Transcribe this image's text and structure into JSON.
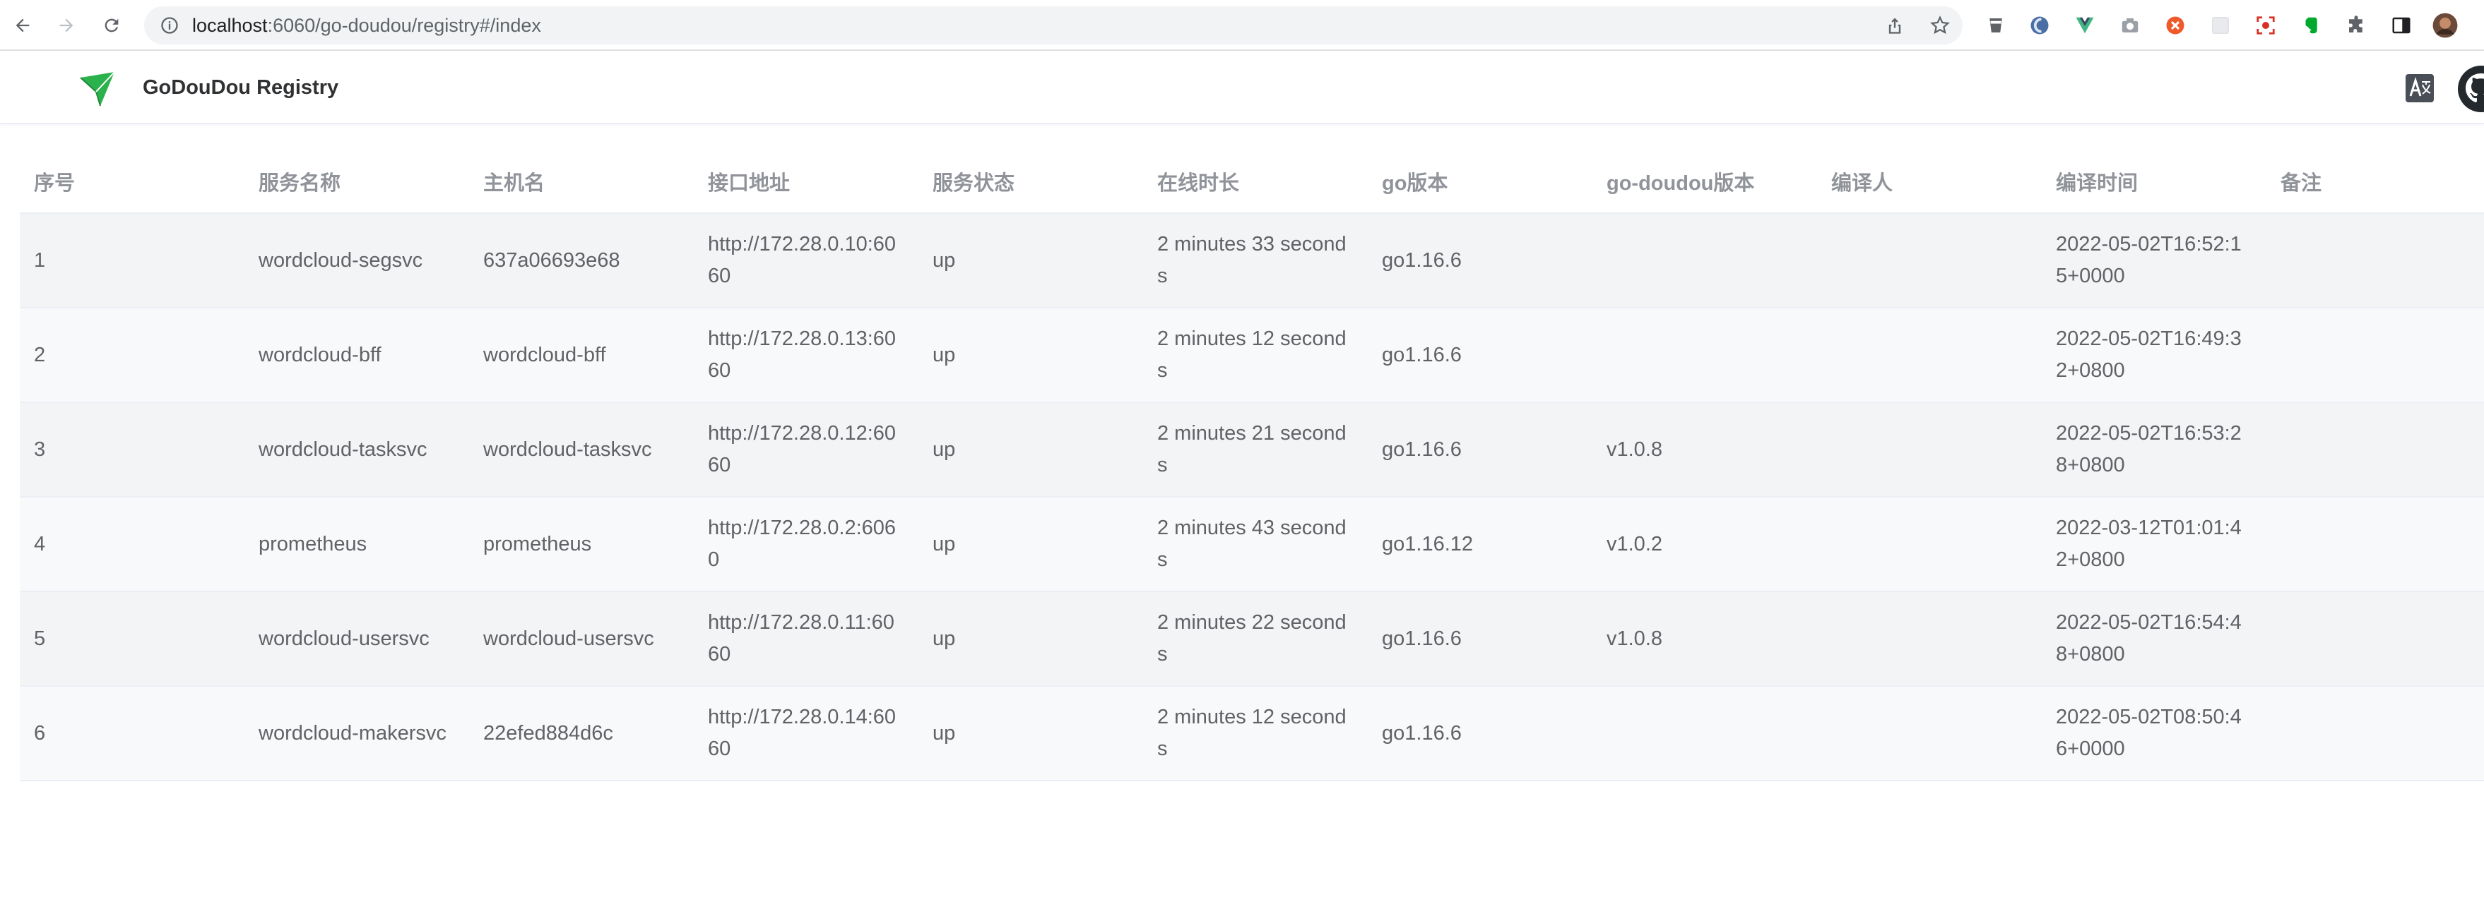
{
  "browser": {
    "url_host": "localhost",
    "url_path": ":6060/go-doudou/registry#/index"
  },
  "app": {
    "title": "GoDouDou Registry",
    "accent": "#2bb24c"
  },
  "table": {
    "columns": [
      "序号",
      "服务名称",
      "主机名",
      "接口地址",
      "服务状态",
      "在线时长",
      "go版本",
      "go-doudou版本",
      "编译人",
      "编译时间",
      "备注"
    ],
    "rows": [
      {
        "index": "1",
        "service": "wordcloud-segsvc",
        "host": "637a06693e68",
        "address": "http://172.28.0.10:6060",
        "status": "up",
        "uptime": "2 minutes 33 seconds",
        "go_version": "go1.16.6",
        "goudou_version": "",
        "builder": "",
        "build_time": "2022-05-02T16:52:15+0000",
        "remark": ""
      },
      {
        "index": "2",
        "service": "wordcloud-bff",
        "host": "wordcloud-bff",
        "address": "http://172.28.0.13:6060",
        "status": "up",
        "uptime": "2 minutes 12 seconds",
        "go_version": "go1.16.6",
        "goudou_version": "",
        "builder": "",
        "build_time": "2022-05-02T16:49:32+0800",
        "remark": ""
      },
      {
        "index": "3",
        "service": "wordcloud-tasksvc",
        "host": "wordcloud-tasksvc",
        "address": "http://172.28.0.12:6060",
        "status": "up",
        "uptime": "2 minutes 21 seconds",
        "go_version": "go1.16.6",
        "goudou_version": "v1.0.8",
        "builder": "",
        "build_time": "2022-05-02T16:53:28+0800",
        "remark": ""
      },
      {
        "index": "4",
        "service": "prometheus",
        "host": "prometheus",
        "address": "http://172.28.0.2:6060",
        "status": "up",
        "uptime": "2 minutes 43 seconds",
        "go_version": "go1.16.12",
        "goudou_version": "v1.0.2",
        "builder": "",
        "build_time": "2022-03-12T01:01:42+0800",
        "remark": ""
      },
      {
        "index": "5",
        "service": "wordcloud-usersvc",
        "host": "wordcloud-usersvc",
        "address": "http://172.28.0.11:6060",
        "status": "up",
        "uptime": "2 minutes 22 seconds",
        "go_version": "go1.16.6",
        "goudou_version": "v1.0.8",
        "builder": "",
        "build_time": "2022-05-02T16:54:48+0800",
        "remark": ""
      },
      {
        "index": "6",
        "service": "wordcloud-makersvc",
        "host": "22efed884d6c",
        "address": "http://172.28.0.14:6060",
        "status": "up",
        "uptime": "2 minutes 12 seconds",
        "go_version": "go1.16.6",
        "goudou_version": "",
        "builder": "",
        "build_time": "2022-05-02T08:50:46+0000",
        "remark": ""
      }
    ]
  }
}
